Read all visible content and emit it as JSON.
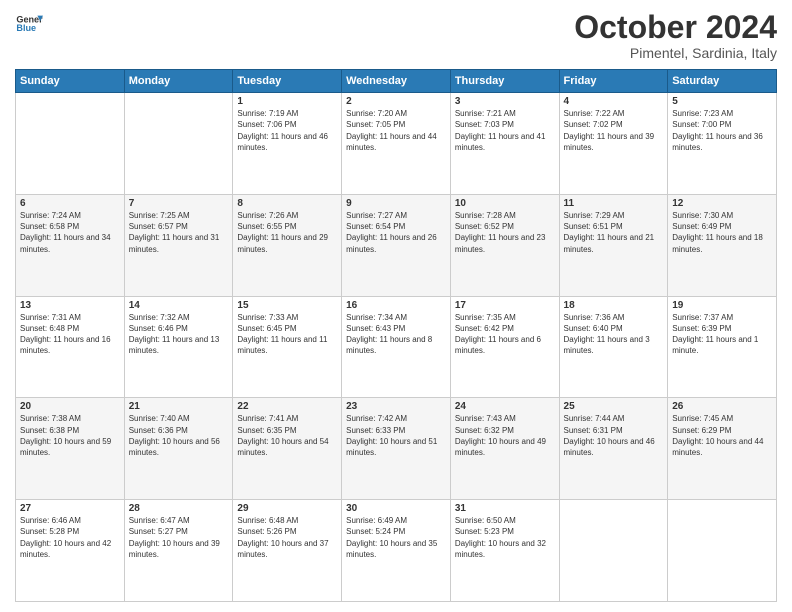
{
  "header": {
    "logo_line1": "General",
    "logo_line2": "Blue",
    "month_title": "October 2024",
    "location": "Pimentel, Sardinia, Italy"
  },
  "days_of_week": [
    "Sunday",
    "Monday",
    "Tuesday",
    "Wednesday",
    "Thursday",
    "Friday",
    "Saturday"
  ],
  "weeks": [
    [
      {
        "day": "",
        "info": ""
      },
      {
        "day": "",
        "info": ""
      },
      {
        "day": "1",
        "info": "Sunrise: 7:19 AM\nSunset: 7:06 PM\nDaylight: 11 hours and 46 minutes."
      },
      {
        "day": "2",
        "info": "Sunrise: 7:20 AM\nSunset: 7:05 PM\nDaylight: 11 hours and 44 minutes."
      },
      {
        "day": "3",
        "info": "Sunrise: 7:21 AM\nSunset: 7:03 PM\nDaylight: 11 hours and 41 minutes."
      },
      {
        "day": "4",
        "info": "Sunrise: 7:22 AM\nSunset: 7:02 PM\nDaylight: 11 hours and 39 minutes."
      },
      {
        "day": "5",
        "info": "Sunrise: 7:23 AM\nSunset: 7:00 PM\nDaylight: 11 hours and 36 minutes."
      }
    ],
    [
      {
        "day": "6",
        "info": "Sunrise: 7:24 AM\nSunset: 6:58 PM\nDaylight: 11 hours and 34 minutes."
      },
      {
        "day": "7",
        "info": "Sunrise: 7:25 AM\nSunset: 6:57 PM\nDaylight: 11 hours and 31 minutes."
      },
      {
        "day": "8",
        "info": "Sunrise: 7:26 AM\nSunset: 6:55 PM\nDaylight: 11 hours and 29 minutes."
      },
      {
        "day": "9",
        "info": "Sunrise: 7:27 AM\nSunset: 6:54 PM\nDaylight: 11 hours and 26 minutes."
      },
      {
        "day": "10",
        "info": "Sunrise: 7:28 AM\nSunset: 6:52 PM\nDaylight: 11 hours and 23 minutes."
      },
      {
        "day": "11",
        "info": "Sunrise: 7:29 AM\nSunset: 6:51 PM\nDaylight: 11 hours and 21 minutes."
      },
      {
        "day": "12",
        "info": "Sunrise: 7:30 AM\nSunset: 6:49 PM\nDaylight: 11 hours and 18 minutes."
      }
    ],
    [
      {
        "day": "13",
        "info": "Sunrise: 7:31 AM\nSunset: 6:48 PM\nDaylight: 11 hours and 16 minutes."
      },
      {
        "day": "14",
        "info": "Sunrise: 7:32 AM\nSunset: 6:46 PM\nDaylight: 11 hours and 13 minutes."
      },
      {
        "day": "15",
        "info": "Sunrise: 7:33 AM\nSunset: 6:45 PM\nDaylight: 11 hours and 11 minutes."
      },
      {
        "day": "16",
        "info": "Sunrise: 7:34 AM\nSunset: 6:43 PM\nDaylight: 11 hours and 8 minutes."
      },
      {
        "day": "17",
        "info": "Sunrise: 7:35 AM\nSunset: 6:42 PM\nDaylight: 11 hours and 6 minutes."
      },
      {
        "day": "18",
        "info": "Sunrise: 7:36 AM\nSunset: 6:40 PM\nDaylight: 11 hours and 3 minutes."
      },
      {
        "day": "19",
        "info": "Sunrise: 7:37 AM\nSunset: 6:39 PM\nDaylight: 11 hours and 1 minute."
      }
    ],
    [
      {
        "day": "20",
        "info": "Sunrise: 7:38 AM\nSunset: 6:38 PM\nDaylight: 10 hours and 59 minutes."
      },
      {
        "day": "21",
        "info": "Sunrise: 7:40 AM\nSunset: 6:36 PM\nDaylight: 10 hours and 56 minutes."
      },
      {
        "day": "22",
        "info": "Sunrise: 7:41 AM\nSunset: 6:35 PM\nDaylight: 10 hours and 54 minutes."
      },
      {
        "day": "23",
        "info": "Sunrise: 7:42 AM\nSunset: 6:33 PM\nDaylight: 10 hours and 51 minutes."
      },
      {
        "day": "24",
        "info": "Sunrise: 7:43 AM\nSunset: 6:32 PM\nDaylight: 10 hours and 49 minutes."
      },
      {
        "day": "25",
        "info": "Sunrise: 7:44 AM\nSunset: 6:31 PM\nDaylight: 10 hours and 46 minutes."
      },
      {
        "day": "26",
        "info": "Sunrise: 7:45 AM\nSunset: 6:29 PM\nDaylight: 10 hours and 44 minutes."
      }
    ],
    [
      {
        "day": "27",
        "info": "Sunrise: 6:46 AM\nSunset: 5:28 PM\nDaylight: 10 hours and 42 minutes."
      },
      {
        "day": "28",
        "info": "Sunrise: 6:47 AM\nSunset: 5:27 PM\nDaylight: 10 hours and 39 minutes."
      },
      {
        "day": "29",
        "info": "Sunrise: 6:48 AM\nSunset: 5:26 PM\nDaylight: 10 hours and 37 minutes."
      },
      {
        "day": "30",
        "info": "Sunrise: 6:49 AM\nSunset: 5:24 PM\nDaylight: 10 hours and 35 minutes."
      },
      {
        "day": "31",
        "info": "Sunrise: 6:50 AM\nSunset: 5:23 PM\nDaylight: 10 hours and 32 minutes."
      },
      {
        "day": "",
        "info": ""
      },
      {
        "day": "",
        "info": ""
      }
    ]
  ]
}
